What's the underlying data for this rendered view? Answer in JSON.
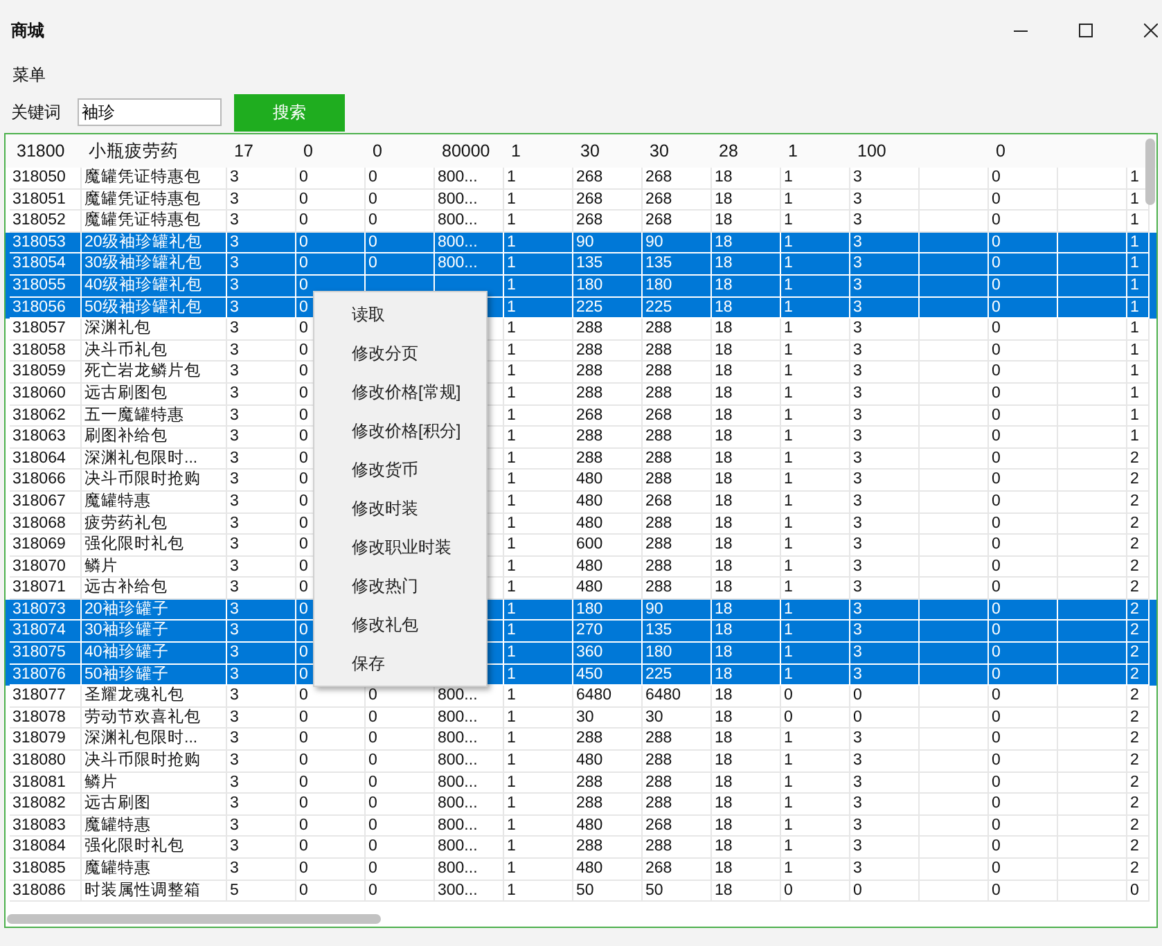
{
  "window": {
    "title": "商城"
  },
  "menu": [
    "菜单"
  ],
  "search": {
    "label": "关键词",
    "value": "袖珍",
    "button": "搜索"
  },
  "grid": {
    "header_row": {
      "column_1": "31800",
      "column_2": "小瓶疲劳药",
      "column_3": "17",
      "column_4": "0",
      "column_5": "0",
      "column_6": "80000",
      "column_7": "1",
      "column_8": "30",
      "column_9": "30",
      "column_10": "28",
      "column_11": "1",
      "column_12": "100",
      "column_14": "0"
    },
    "rows": [
      {
        "column_1": "318050",
        "column_2": "魔罐凭证特惠包",
        "column_3": "3",
        "column_4": "0",
        "column_5": "0",
        "column_6": "800...",
        "column_7": "1",
        "column_8": "268",
        "column_9": "268",
        "column_10": "18",
        "column_11": "1",
        "column_12": "3",
        "column_14": "0",
        "column_16": "1",
        "selected": false
      },
      {
        "column_1": "318051",
        "column_2": "魔罐凭证特惠包",
        "column_3": "3",
        "column_4": "0",
        "column_5": "0",
        "column_6": "800...",
        "column_7": "1",
        "column_8": "268",
        "column_9": "268",
        "column_10": "18",
        "column_11": "1",
        "column_12": "3",
        "column_14": "0",
        "column_16": "1",
        "selected": false
      },
      {
        "column_1": "318052",
        "column_2": "魔罐凭证特惠包",
        "column_3": "3",
        "column_4": "0",
        "column_5": "0",
        "column_6": "800...",
        "column_7": "1",
        "column_8": "268",
        "column_9": "268",
        "column_10": "18",
        "column_11": "1",
        "column_12": "3",
        "column_14": "0",
        "column_16": "1",
        "selected": false
      },
      {
        "column_1": "318053",
        "column_2": "20级袖珍罐礼包",
        "column_3": "3",
        "column_4": "0",
        "column_5": "0",
        "column_6": "800...",
        "column_7": "1",
        "column_8": "90",
        "column_9": "90",
        "column_10": "18",
        "column_11": "1",
        "column_12": "3",
        "column_14": "0",
        "column_16": "1",
        "selected": true
      },
      {
        "column_1": "318054",
        "column_2": "30级袖珍罐礼包",
        "column_3": "3",
        "column_4": "0",
        "column_5": "0",
        "column_6": "800...",
        "column_7": "1",
        "column_8": "135",
        "column_9": "135",
        "column_10": "18",
        "column_11": "1",
        "column_12": "3",
        "column_14": "0",
        "column_16": "1",
        "selected": true
      },
      {
        "column_1": "318055",
        "column_2": "40级袖珍罐礼包",
        "column_3": "3",
        "column_4": "0",
        "column_7": "1",
        "column_8": "180",
        "column_9": "180",
        "column_10": "18",
        "column_11": "1",
        "column_12": "3",
        "column_14": "0",
        "column_16": "1",
        "selected": true
      },
      {
        "column_1": "318056",
        "column_2": "50级袖珍罐礼包",
        "column_3": "3",
        "column_4": "0",
        "column_7": "1",
        "column_8": "225",
        "column_9": "225",
        "column_10": "18",
        "column_11": "1",
        "column_12": "3",
        "column_14": "0",
        "column_16": "1",
        "selected": true
      },
      {
        "column_1": "318057",
        "column_2": "深渊礼包",
        "column_3": "3",
        "column_4": "0",
        "column_7": "1",
        "column_8": "288",
        "column_9": "288",
        "column_10": "18",
        "column_11": "1",
        "column_12": "3",
        "column_14": "0",
        "column_16": "1",
        "selected": false
      },
      {
        "column_1": "318058",
        "column_2": "决斗币礼包",
        "column_3": "3",
        "column_4": "0",
        "column_7": "1",
        "column_8": "288",
        "column_9": "288",
        "column_10": "18",
        "column_11": "1",
        "column_12": "3",
        "column_14": "0",
        "column_16": "1",
        "selected": false
      },
      {
        "column_1": "318059",
        "column_2": "死亡岩龙鳞片包",
        "column_3": "3",
        "column_4": "0",
        "column_7": "1",
        "column_8": "288",
        "column_9": "288",
        "column_10": "18",
        "column_11": "1",
        "column_12": "3",
        "column_14": "0",
        "column_16": "1",
        "selected": false
      },
      {
        "column_1": "318060",
        "column_2": "远古刷图包",
        "column_3": "3",
        "column_4": "0",
        "column_7": "1",
        "column_8": "288",
        "column_9": "288",
        "column_10": "18",
        "column_11": "1",
        "column_12": "3",
        "column_14": "0",
        "column_16": "1",
        "selected": false
      },
      {
        "column_1": "318062",
        "column_2": "五一魔罐特惠",
        "column_3": "3",
        "column_4": "0",
        "column_7": "1",
        "column_8": "268",
        "column_9": "268",
        "column_10": "18",
        "column_11": "1",
        "column_12": "3",
        "column_14": "0",
        "column_16": "1",
        "selected": false
      },
      {
        "column_1": "318063",
        "column_2": "刷图补给包",
        "column_3": "3",
        "column_4": "0",
        "column_7": "1",
        "column_8": "288",
        "column_9": "288",
        "column_10": "18",
        "column_11": "1",
        "column_12": "3",
        "column_14": "0",
        "column_16": "1",
        "selected": false
      },
      {
        "column_1": "318064",
        "column_2": "深渊礼包限时...",
        "column_3": "3",
        "column_4": "0",
        "column_7": "1",
        "column_8": "288",
        "column_9": "288",
        "column_10": "18",
        "column_11": "1",
        "column_12": "3",
        "column_14": "0",
        "column_16": "2",
        "selected": false
      },
      {
        "column_1": "318066",
        "column_2": "决斗币限时抢购",
        "column_3": "3",
        "column_4": "0",
        "column_7": "1",
        "column_8": "480",
        "column_9": "288",
        "column_10": "18",
        "column_11": "1",
        "column_12": "3",
        "column_14": "0",
        "column_16": "2",
        "selected": false
      },
      {
        "column_1": "318067",
        "column_2": "魔罐特惠",
        "column_3": "3",
        "column_4": "0",
        "column_7": "1",
        "column_8": "480",
        "column_9": "268",
        "column_10": "18",
        "column_11": "1",
        "column_12": "3",
        "column_14": "0",
        "column_16": "2",
        "selected": false
      },
      {
        "column_1": "318068",
        "column_2": "疲劳药礼包",
        "column_3": "3",
        "column_4": "0",
        "column_7": "1",
        "column_8": "480",
        "column_9": "288",
        "column_10": "18",
        "column_11": "1",
        "column_12": "3",
        "column_14": "0",
        "column_16": "2",
        "selected": false
      },
      {
        "column_1": "318069",
        "column_2": "强化限时礼包",
        "column_3": "3",
        "column_4": "0",
        "column_7": "1",
        "column_8": "600",
        "column_9": "288",
        "column_10": "18",
        "column_11": "1",
        "column_12": "3",
        "column_14": "0",
        "column_16": "2",
        "selected": false
      },
      {
        "column_1": "318070",
        "column_2": "鳞片",
        "column_3": "3",
        "column_4": "0",
        "column_7": "1",
        "column_8": "480",
        "column_9": "288",
        "column_10": "18",
        "column_11": "1",
        "column_12": "3",
        "column_14": "0",
        "column_16": "2",
        "selected": false
      },
      {
        "column_1": "318071",
        "column_2": "远古补给包",
        "column_3": "3",
        "column_4": "0",
        "column_7": "1",
        "column_8": "480",
        "column_9": "288",
        "column_10": "18",
        "column_11": "1",
        "column_12": "3",
        "column_14": "0",
        "column_16": "2",
        "selected": false
      },
      {
        "column_1": "318073",
        "column_2": "20袖珍罐子",
        "column_3": "3",
        "column_4": "0",
        "column_7": "1",
        "column_8": "180",
        "column_9": "90",
        "column_10": "18",
        "column_11": "1",
        "column_12": "3",
        "column_14": "0",
        "column_16": "2",
        "selected": true
      },
      {
        "column_1": "318074",
        "column_2": "30袖珍罐子",
        "column_3": "3",
        "column_4": "0",
        "column_7": "1",
        "column_8": "270",
        "column_9": "135",
        "column_10": "18",
        "column_11": "1",
        "column_12": "3",
        "column_14": "0",
        "column_16": "2",
        "selected": true
      },
      {
        "column_1": "318075",
        "column_2": "40袖珍罐子",
        "column_3": "3",
        "column_4": "0",
        "column_7": "1",
        "column_8": "360",
        "column_9": "180",
        "column_10": "18",
        "column_11": "1",
        "column_12": "3",
        "column_14": "0",
        "column_16": "2",
        "selected": true
      },
      {
        "column_1": "318076",
        "column_2": "50袖珍罐子",
        "column_3": "3",
        "column_4": "0",
        "column_7": "1",
        "column_8": "450",
        "column_9": "225",
        "column_10": "18",
        "column_11": "1",
        "column_12": "3",
        "column_14": "0",
        "column_16": "2",
        "selected": true
      },
      {
        "column_1": "318077",
        "column_2": "圣耀龙魂礼包",
        "column_3": "3",
        "column_4": "0",
        "column_5": "0",
        "column_6": "800...",
        "column_7": "1",
        "column_8": "6480",
        "column_9": "6480",
        "column_10": "18",
        "column_11": "0",
        "column_12": "0",
        "column_14": "0",
        "column_16": "2",
        "selected": false
      },
      {
        "column_1": "318078",
        "column_2": "劳动节欢喜礼包",
        "column_3": "3",
        "column_4": "0",
        "column_5": "0",
        "column_6": "800...",
        "column_7": "1",
        "column_8": "30",
        "column_9": "30",
        "column_10": "18",
        "column_11": "0",
        "column_12": "0",
        "column_14": "0",
        "column_16": "2",
        "selected": false
      },
      {
        "column_1": "318079",
        "column_2": "深渊礼包限时...",
        "column_3": "3",
        "column_4": "0",
        "column_5": "0",
        "column_6": "800...",
        "column_7": "1",
        "column_8": "288",
        "column_9": "288",
        "column_10": "18",
        "column_11": "1",
        "column_12": "3",
        "column_14": "0",
        "column_16": "2",
        "selected": false
      },
      {
        "column_1": "318080",
        "column_2": "决斗币限时抢购",
        "column_3": "3",
        "column_4": "0",
        "column_5": "0",
        "column_6": "800...",
        "column_7": "1",
        "column_8": "480",
        "column_9": "288",
        "column_10": "18",
        "column_11": "1",
        "column_12": "3",
        "column_14": "0",
        "column_16": "2",
        "selected": false
      },
      {
        "column_1": "318081",
        "column_2": "鳞片",
        "column_3": "3",
        "column_4": "0",
        "column_5": "0",
        "column_6": "800...",
        "column_7": "1",
        "column_8": "288",
        "column_9": "288",
        "column_10": "18",
        "column_11": "1",
        "column_12": "3",
        "column_14": "0",
        "column_16": "2",
        "selected": false
      },
      {
        "column_1": "318082",
        "column_2": "远古刷图",
        "column_3": "3",
        "column_4": "0",
        "column_5": "0",
        "column_6": "800...",
        "column_7": "1",
        "column_8": "288",
        "column_9": "288",
        "column_10": "18",
        "column_11": "1",
        "column_12": "3",
        "column_14": "0",
        "column_16": "2",
        "selected": false
      },
      {
        "column_1": "318083",
        "column_2": "魔罐特惠",
        "column_3": "3",
        "column_4": "0",
        "column_5": "0",
        "column_6": "800...",
        "column_7": "1",
        "column_8": "480",
        "column_9": "268",
        "column_10": "18",
        "column_11": "1",
        "column_12": "3",
        "column_14": "0",
        "column_16": "2",
        "selected": false
      },
      {
        "column_1": "318084",
        "column_2": "强化限时礼包",
        "column_3": "3",
        "column_4": "0",
        "column_5": "0",
        "column_6": "800...",
        "column_7": "1",
        "column_8": "288",
        "column_9": "288",
        "column_10": "18",
        "column_11": "1",
        "column_12": "3",
        "column_14": "0",
        "column_16": "2",
        "selected": false
      },
      {
        "column_1": "318085",
        "column_2": "魔罐特惠",
        "column_3": "3",
        "column_4": "0",
        "column_5": "0",
        "column_6": "800...",
        "column_7": "1",
        "column_8": "480",
        "column_9": "268",
        "column_10": "18",
        "column_11": "1",
        "column_12": "3",
        "column_14": "0",
        "column_16": "2",
        "selected": false
      },
      {
        "column_1": "318086",
        "column_2": "时装属性调整箱",
        "column_3": "5",
        "column_4": "0",
        "column_5": "0",
        "column_6": "300...",
        "column_7": "1",
        "column_8": "50",
        "column_9": "50",
        "column_10": "18",
        "column_11": "0",
        "column_12": "0",
        "column_14": "0",
        "column_16": "0",
        "selected": false
      }
    ]
  },
  "context_menu": {
    "items": [
      "读取",
      "修改分页",
      "修改价格[常规]",
      "修改价格[积分]",
      "修改货币",
      "修改时装",
      "修改职业时装",
      "修改热门",
      "修改礼包",
      "保存"
    ]
  }
}
